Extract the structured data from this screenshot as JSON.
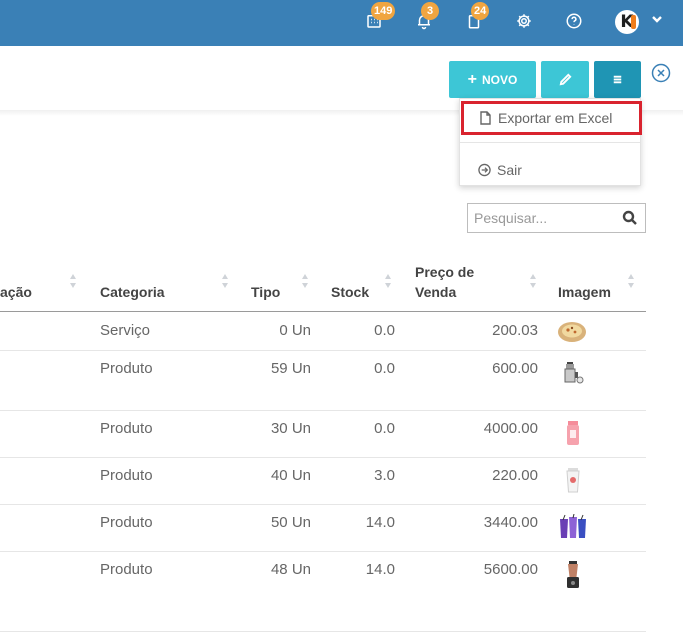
{
  "topbar": {
    "calendar_badge": "149",
    "bell_badge": "3",
    "clipboard_badge": "24",
    "avatar_letter": "K",
    "accent": "#3a80b6"
  },
  "toolbar": {
    "novo_label": "NOVO",
    "novo_color": "#3dc6d6",
    "menu_color": "#1f95b4"
  },
  "dropdown": {
    "export_label": "Exportar em Excel",
    "sair_label": "Sair",
    "highlight_color": "#d9232e"
  },
  "search": {
    "placeholder": "Pesquisar..."
  },
  "table": {
    "headers": {
      "designacao": "ação",
      "categoria": "Categoria",
      "tipo": "Tipo",
      "stock": "Stock",
      "preco_line1": "Preço de",
      "preco_line2": "Venda",
      "imagem": "Imagem"
    },
    "rows": [
      {
        "categoria": "Serviço",
        "tipo": "0 Un",
        "stock": "0.0",
        "preco": "200.03",
        "image": "pizza-thumbnail"
      },
      {
        "categoria": "Produto",
        "tipo": "59 Un",
        "stock": "0.0",
        "preco": "600.00",
        "image": "coffee-maker-thumbnail"
      },
      {
        "categoria": "Produto",
        "tipo": "30 Un",
        "stock": "0.0",
        "preco": "4000.00",
        "image": "pink-bottle-thumbnail"
      },
      {
        "categoria": "Produto",
        "tipo": "40 Un",
        "stock": "3.0",
        "preco": "220.00",
        "image": "white-cup-thumbnail"
      },
      {
        "categoria": "Produto",
        "tipo": "50 Un",
        "stock": "14.0",
        "preco": "3440.00",
        "image": "purple-cups-thumbnail"
      },
      {
        "categoria": "Produto",
        "tipo": "48 Un",
        "stock": "14.0",
        "preco": "5600.00",
        "image": "blender-thumbnail"
      }
    ]
  }
}
